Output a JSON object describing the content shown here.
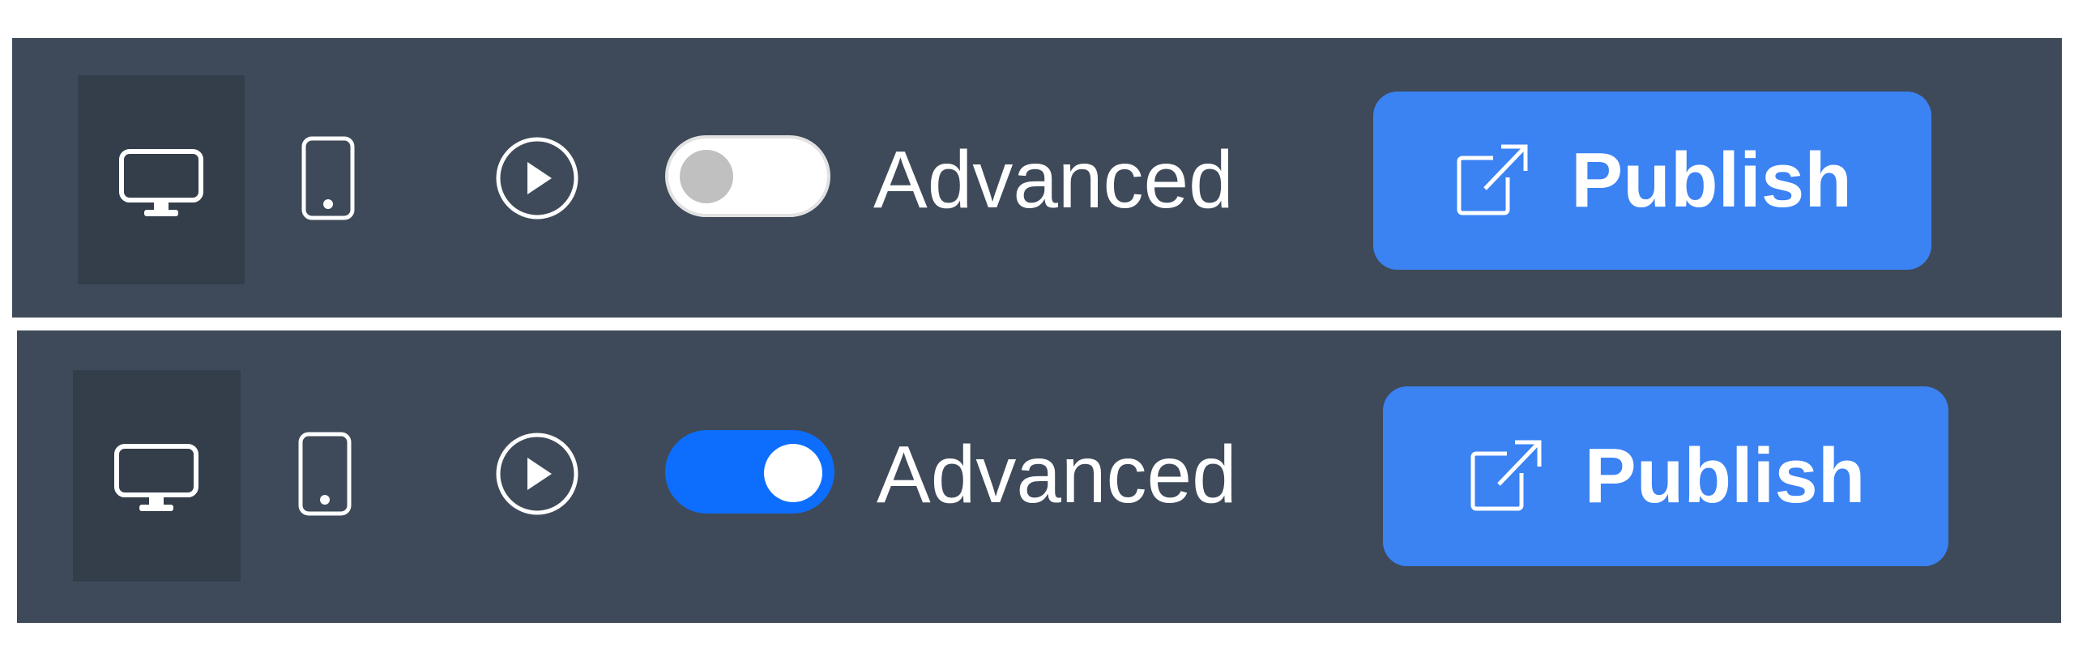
{
  "toolbars": [
    {
      "state": "advanced-off",
      "device_buttons": [
        {
          "name": "desktop",
          "icon": "monitor-icon",
          "selected": true
        },
        {
          "name": "mobile",
          "icon": "phone-icon",
          "selected": false
        }
      ],
      "preview_icon": "play-circle-icon",
      "advanced_toggle": {
        "label": "Advanced",
        "on": false,
        "track_color": "#ffffff",
        "knob_color": "#c0c0c0"
      },
      "publish_button": {
        "label": "Publish",
        "icon": "external-link-icon",
        "color": "#3b82f3"
      }
    },
    {
      "state": "advanced-on",
      "device_buttons": [
        {
          "name": "desktop",
          "icon": "monitor-icon",
          "selected": true
        },
        {
          "name": "mobile",
          "icon": "phone-icon",
          "selected": false
        }
      ],
      "preview_icon": "play-circle-icon",
      "advanced_toggle": {
        "label": "Advanced",
        "on": true,
        "track_color": "#0d6efd",
        "knob_color": "#ffffff"
      },
      "publish_button": {
        "label": "Publish",
        "icon": "external-link-icon",
        "color": "#3b82f3"
      }
    }
  ],
  "colors": {
    "toolbar_bg": "#3e4a59",
    "selected_device_bg": "#343d4a",
    "accent": "#3b82f3"
  }
}
